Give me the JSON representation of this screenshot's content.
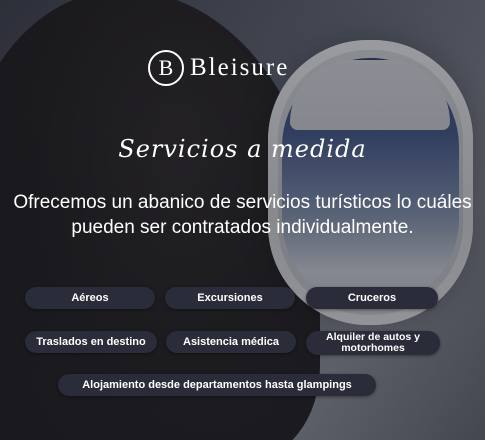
{
  "brand": {
    "logo_mark": "B",
    "name": "Bleisure"
  },
  "heading": {
    "script_title": "Servicios a medida"
  },
  "description": "Ofrecemos un abanico de servicios turísticos lo cuáles pueden ser contratados individualmente.",
  "services": [
    "Aéreos",
    "Excursiones",
    "Cruceros",
    "Traslados en destino",
    "Asistencia médica",
    "Alquiler de autos y motorhomes",
    "Alojamiento desde departamentos hasta glampings"
  ],
  "colors": {
    "pill_background": "#2a2c39",
    "text": "#ffffff"
  }
}
